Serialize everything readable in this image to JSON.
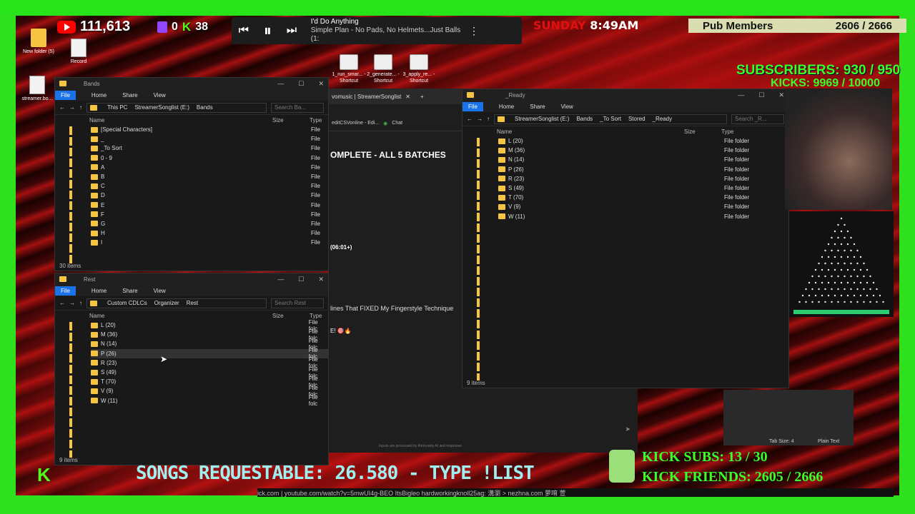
{
  "overlay": {
    "youtube_count": "111,613",
    "twitch_count": "0",
    "kick_count": "38",
    "track_title": "I'd Do Anything",
    "track_subtitle": "Simple Plan - No Pads, No Helmets...Just Balls (1:",
    "day": "SUNDAY",
    "time": "8:49AM",
    "pub_label": "Pub Members",
    "pub_value": "2606 / 2666",
    "subscribers": "SUBSCRIBERS: 930 / 950",
    "kicks": "KICKS: 9969 / 10000",
    "songs_requestable": "SONGS REQUESTABLE: 26.580 - TYPE !LIST",
    "kick_subs": "KICK SUBS: 13 / 30",
    "kick_friends": "KICK FRIENDS: 2605 / 2666",
    "ticker": "ick.com | youtube.com/watch?v=5mwUI4g-BEO  ItsBigleo  hardworkingknoll25ag: 溝瀏 > nezhna.com 萝唷 萱"
  },
  "desktop": {
    "icons": [
      {
        "label": "New folder (5)"
      },
      {
        "label": "Record"
      },
      {
        "label": "streamer.bo..."
      },
      {
        "label": "1_run_smar... - Shortcut"
      },
      {
        "label": "2_generate... - Shortcut"
      },
      {
        "label": "3_apply_re... - Shortcut"
      }
    ]
  },
  "window_bands": {
    "title": "Bands",
    "ribbon": [
      "File",
      "Home",
      "Share",
      "View"
    ],
    "path": [
      "This PC",
      "StreamerSonglist (E:)",
      "Bands"
    ],
    "search": "Search Ba...",
    "columns": [
      "Name",
      "Size",
      "Type"
    ],
    "rows": [
      "[Special Characters]",
      "_",
      "_To Sort",
      "0 - 9",
      "A",
      "B",
      "C",
      "D",
      "E",
      "F",
      "G",
      "H",
      "I"
    ],
    "type_value": "File",
    "status": "30 items"
  },
  "window_rest": {
    "title": "Rest",
    "ribbon": [
      "File",
      "Home",
      "Share",
      "View"
    ],
    "path": [
      "Custom CDLCs",
      "Organizer",
      "Rest"
    ],
    "search": "Search Rest",
    "columns": [
      "Name",
      "Size",
      "Type"
    ],
    "rows": [
      "L (20)",
      "M (36)",
      "N (14)",
      "P (26)",
      "R (23)",
      "S (49)",
      "T (70)",
      "V (9)",
      "W (11)"
    ],
    "type_value": "File folc",
    "status": "9 items"
  },
  "window_ready": {
    "title": "_Ready",
    "ribbon": [
      "File",
      "Home",
      "Share",
      "View"
    ],
    "path": [
      "StreamerSonglist (E:)",
      "Bands",
      "_To Sort",
      "Stored",
      "_Ready"
    ],
    "search": "Search _R...",
    "columns": [
      "Name",
      "Size",
      "Type"
    ],
    "rows": [
      "L (20)",
      "M (36)",
      "N (14)",
      "P (26)",
      "R (23)",
      "S (49)",
      "T (70)",
      "V (9)",
      "W (11)"
    ],
    "type_value": "File folder",
    "status": "9 items"
  },
  "browser": {
    "tab": "vomusic | StreamerSonglist",
    "bookmark1": "editCSVonline - Edi...",
    "bookmark2": "Chat",
    "heading": "OMPLETE - ALL 5 BATCHES",
    "time_text": "(06:01+)",
    "video_title": "lines That FIXED My Fingerstyle Technique",
    "emoji_text": "E! 🎯🔥",
    "footer": "Inputs are processed by third-party AI and responses may be inaccurate.",
    "tab_size": "Tab Size: 4",
    "plain_text": "Plain Text"
  }
}
